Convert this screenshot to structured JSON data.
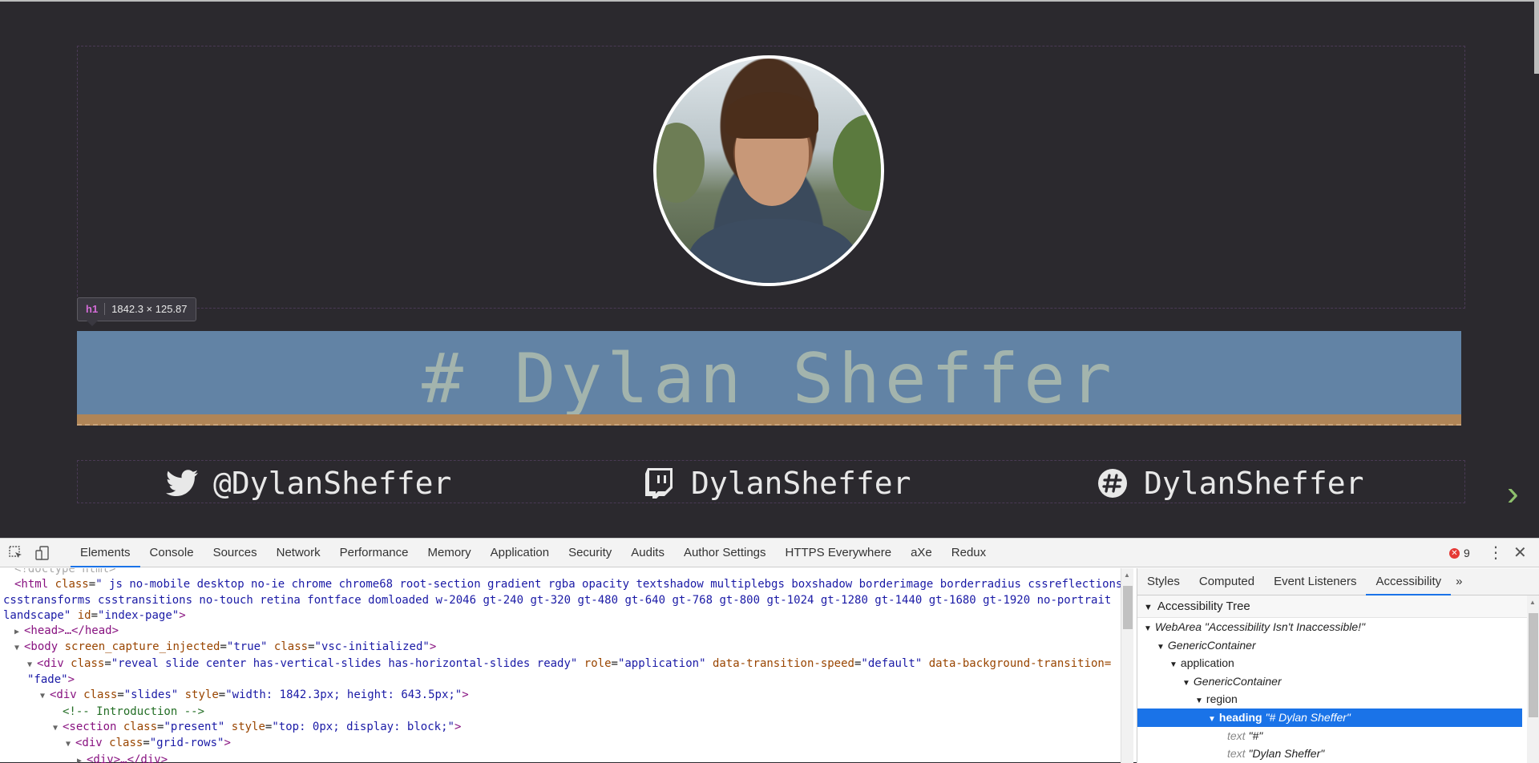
{
  "slide": {
    "tooltip": {
      "tag": "h1",
      "size": "1842.3 × 125.87"
    },
    "heading": "# Dylan Sheffer",
    "social": [
      {
        "icon": "twitter-icon",
        "label": "@DylanSheffer"
      },
      {
        "icon": "twitch-icon",
        "label": "DylanSheffer"
      },
      {
        "icon": "slack-icon",
        "label": "DylanSheffer"
      }
    ],
    "colors": {
      "heading_bg": "#6283a5",
      "heading_text": "#a3b4ad",
      "padding_overlay": "#b08557",
      "next_arrow": "#8ec06c"
    }
  },
  "devtools": {
    "tabs": [
      "Elements",
      "Console",
      "Sources",
      "Network",
      "Performance",
      "Memory",
      "Application",
      "Security",
      "Audits",
      "Author Settings",
      "HTTPS Everywhere",
      "aXe",
      "Redux"
    ],
    "active_tab": "Elements",
    "error_count": "9",
    "side_tabs": [
      "Styles",
      "Computed",
      "Event Listeners",
      "Accessibility"
    ],
    "side_more": "»",
    "ax_title": "Accessibility Tree",
    "ax_tree": [
      {
        "type": "WebArea",
        "name": "\"Accessibility Isn't Inaccessible!\""
      },
      {
        "type": "GenericContainer",
        "name": ""
      },
      {
        "type": "application",
        "name": ""
      },
      {
        "type": "GenericContainer",
        "name": ""
      },
      {
        "type": "region",
        "name": ""
      },
      {
        "type": "heading",
        "name": "\"# Dylan Sheffer\""
      },
      {
        "type": "text",
        "name": "\"#\""
      },
      {
        "type": "text",
        "name": "\"Dylan Sheffer\""
      }
    ],
    "dom": {
      "doctype": "<!doctype html>",
      "html_tag": "<html",
      "html_class_attr": "class",
      "html_class_value": "\" js no-mobile desktop no-ie chrome chrome68 root-section gradient rgba opacity textshadow multiplebgs boxshadow borderimage borderradius cssreflections",
      "html_class_value_2": "csstransforms csstransitions no-touch retina fontface domloaded w-2046 gt-240 gt-320 gt-480 gt-640 gt-768 gt-800 gt-1024 gt-1280 gt-1440 gt-1680 gt-1920 no-portrait",
      "html_class_value_3": "landscape\"",
      "html_id_attr": "id",
      "html_id_value": "\"index-page\"",
      "head": "<head>…</head>",
      "body_tag": "<body",
      "body_attr1": "screen_capture_injected",
      "body_val1": "\"true\"",
      "body_attr2": "class",
      "body_val2": "\"vsc-initialized\"",
      "div1_tag": "<div",
      "div1_class_attr": "class",
      "div1_class_val": "\"reveal slide center has-vertical-slides has-horizontal-slides ready\"",
      "div1_role_attr": "role",
      "div1_role_val": "\"application\"",
      "div1_ts_attr": "data-transition-speed",
      "div1_ts_val": "\"default\"",
      "div1_bt_attr": "data-background-transition=",
      "div1_bt_val": "\"fade\"",
      "div2_tag": "<div",
      "div2_class_attr": "class",
      "div2_class_val": "\"slides\"",
      "div2_style_attr": "style",
      "div2_style_val": "\"width: 1842.3px; height: 643.5px;\"",
      "comment": "<!-- Introduction -->",
      "section_tag": "<section",
      "section_class_attr": "class",
      "section_class_val": "\"present\"",
      "section_style_attr": "style",
      "section_style_val": "\"top: 0px; display: block;\"",
      "div3_tag": "<div",
      "div3_class_attr": "class",
      "div3_class_val": "\"grid-rows\"",
      "div4": "<div>…</div>"
    }
  }
}
